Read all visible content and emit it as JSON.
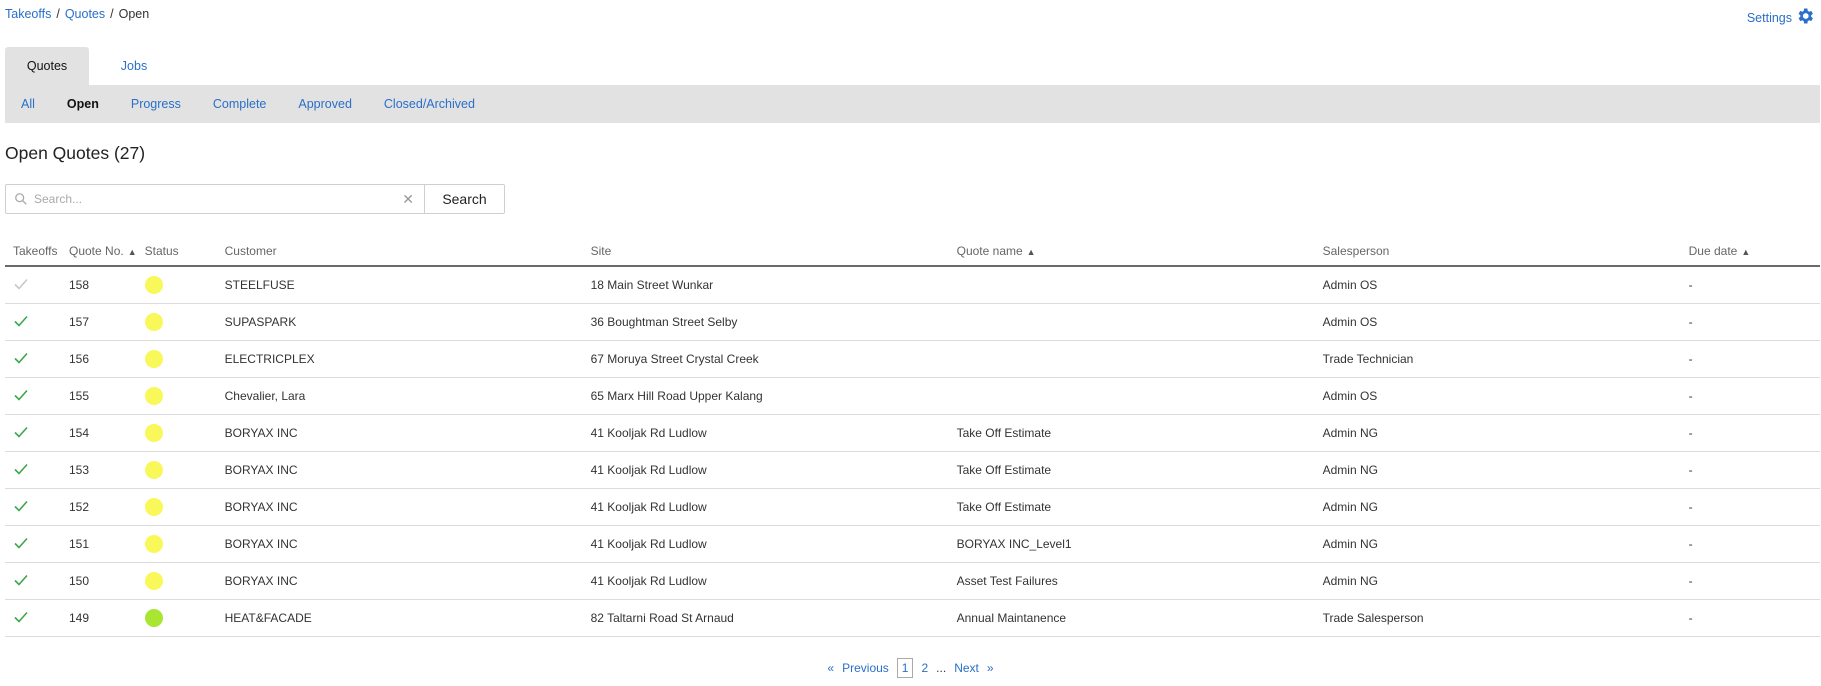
{
  "breadcrumb": {
    "items": [
      "Takeoffs",
      "Quotes"
    ],
    "current": "Open",
    "separator": "/"
  },
  "settings": {
    "label": "Settings",
    "icon": "gear-icon"
  },
  "tabs": [
    {
      "label": "Quotes",
      "active": true
    },
    {
      "label": "Jobs",
      "active": false
    }
  ],
  "subtabs": [
    {
      "label": "All",
      "active": false
    },
    {
      "label": "Open",
      "active": true
    },
    {
      "label": "Progress",
      "active": false
    },
    {
      "label": "Complete",
      "active": false
    },
    {
      "label": "Approved",
      "active": false
    },
    {
      "label": "Closed/Archived",
      "active": false
    }
  ],
  "page_title": "Open Quotes (27)",
  "search": {
    "placeholder": "Search...",
    "value": "",
    "button_label": "Search"
  },
  "table": {
    "columns": [
      {
        "label": "Takeoffs",
        "sort": ""
      },
      {
        "label": "Quote No.",
        "sort": "▲"
      },
      {
        "label": "Status",
        "sort": ""
      },
      {
        "label": "Customer",
        "sort": ""
      },
      {
        "label": "Site",
        "sort": ""
      },
      {
        "label": "Quote name",
        "sort": "▲"
      },
      {
        "label": "Salesperson",
        "sort": ""
      },
      {
        "label": "Due date",
        "sort": "▲"
      }
    ],
    "rows": [
      {
        "takeoff": "faded",
        "quote_no": "158",
        "status": "yellow",
        "customer": "STEELFUSE",
        "site": "18 Main Street Wunkar",
        "quote_name": "",
        "salesperson": "Admin OS",
        "due": "-"
      },
      {
        "takeoff": "green",
        "quote_no": "157",
        "status": "yellow",
        "customer": "SUPASPARK",
        "site": "36 Boughtman Street Selby",
        "quote_name": "",
        "salesperson": "Admin OS",
        "due": "-"
      },
      {
        "takeoff": "green",
        "quote_no": "156",
        "status": "yellow",
        "customer": "ELECTRICPLEX",
        "site": "67 Moruya Street Crystal Creek",
        "quote_name": "",
        "salesperson": "Trade Technician",
        "due": "-"
      },
      {
        "takeoff": "green",
        "quote_no": "155",
        "status": "yellow",
        "customer": "Chevalier, Lara",
        "site": "65 Marx Hill Road Upper Kalang",
        "quote_name": "",
        "salesperson": "Admin OS",
        "due": "-"
      },
      {
        "takeoff": "green",
        "quote_no": "154",
        "status": "yellow",
        "customer": "BORYAX INC",
        "site": "41 Kooljak Rd Ludlow",
        "quote_name": "Take Off Estimate",
        "salesperson": "Admin NG",
        "due": "-"
      },
      {
        "takeoff": "green",
        "quote_no": "153",
        "status": "yellow",
        "customer": "BORYAX INC",
        "site": "41 Kooljak Rd Ludlow",
        "quote_name": "Take Off Estimate",
        "salesperson": "Admin NG",
        "due": "-"
      },
      {
        "takeoff": "green",
        "quote_no": "152",
        "status": "yellow",
        "customer": "BORYAX INC",
        "site": "41 Kooljak Rd Ludlow",
        "quote_name": "Take Off Estimate",
        "salesperson": "Admin NG",
        "due": "-"
      },
      {
        "takeoff": "green",
        "quote_no": "151",
        "status": "yellow",
        "customer": "BORYAX INC",
        "site": "41 Kooljak Rd Ludlow",
        "quote_name": "BORYAX INC_Level1",
        "salesperson": "Admin NG",
        "due": "-"
      },
      {
        "takeoff": "green",
        "quote_no": "150",
        "status": "yellow",
        "customer": "BORYAX INC",
        "site": "41 Kooljak Rd Ludlow",
        "quote_name": "Asset Test Failures",
        "salesperson": "Admin NG",
        "due": "-"
      },
      {
        "takeoff": "green",
        "quote_no": "149",
        "status": "lime",
        "customer": "HEAT&FACADE",
        "site": "82 Taltarni Road St Arnaud",
        "quote_name": "Annual Maintanence",
        "salesperson": "Trade Salesperson",
        "due": "-"
      }
    ]
  },
  "pagination": {
    "first": "«",
    "previous": "Previous",
    "pages": [
      "1",
      "2"
    ],
    "current": "1",
    "ellipsis": "...",
    "next": "Next",
    "last": "»"
  },
  "colors": {
    "link": "#2a6fc9",
    "status_yellow": "#f8f85a",
    "status_lime": "#a8e633",
    "check_green": "#3aa84a",
    "check_faded": "#c8c8c8",
    "tab_bg": "#e2e2e2"
  }
}
